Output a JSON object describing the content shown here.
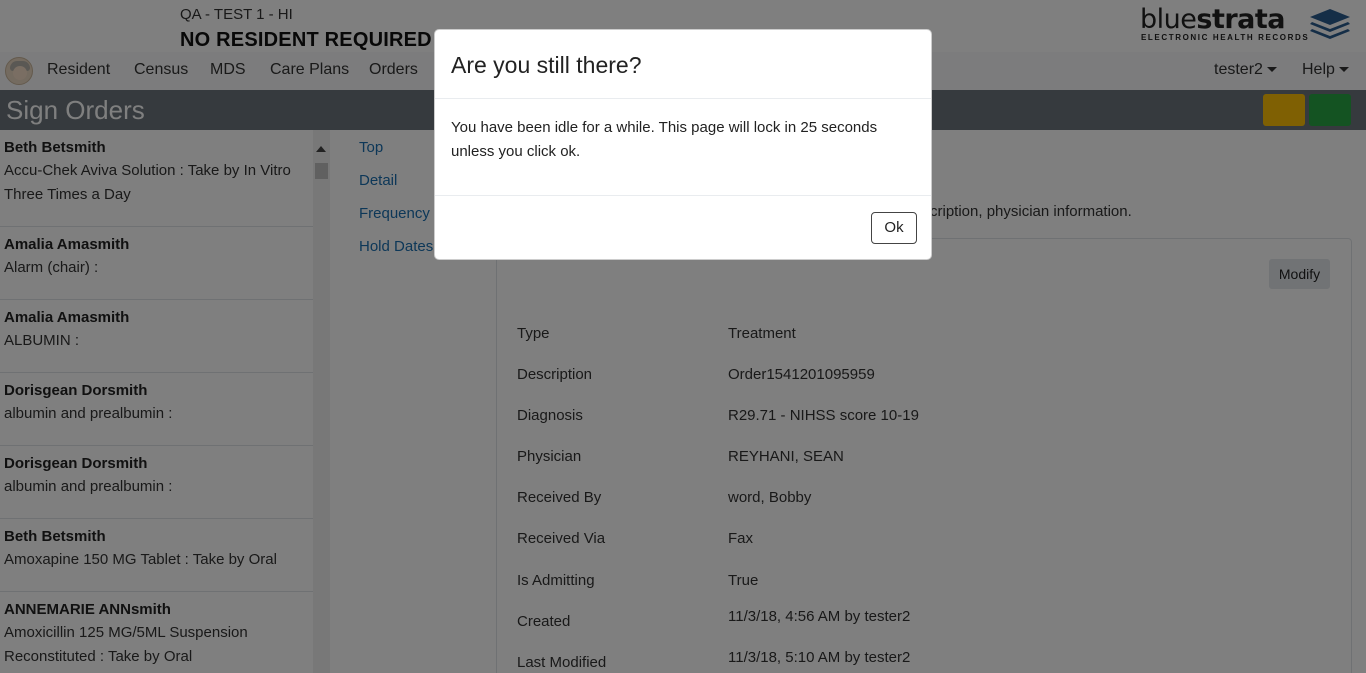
{
  "header": {
    "facility": "QA - TEST 1 - HI",
    "resident": "NO RESIDENT REQUIRED",
    "logo_blue": "blue",
    "logo_strata": "strata",
    "logo_sub": "ELECTRONIC HEALTH RECORDS"
  },
  "nav": {
    "items": [
      "Resident",
      "Census",
      "MDS",
      "Care Plans",
      "Orders"
    ],
    "user": "tester2",
    "help": "Help"
  },
  "page": {
    "title": "Sign Orders"
  },
  "orders": [
    {
      "name": "Beth Betsmith",
      "desc": "Accu-Chek Aviva Solution : Take by In Vitro Three Times a Day"
    },
    {
      "name": "Amalia Amasmith",
      "desc": "Alarm (chair) :"
    },
    {
      "name": "Amalia Amasmith",
      "desc": "ALBUMIN :"
    },
    {
      "name": "Dorisgean Dorsmith",
      "desc": "albumin and prealbumin :"
    },
    {
      "name": "Dorisgean Dorsmith",
      "desc": "albumin and prealbumin :"
    },
    {
      "name": "Beth Betsmith",
      "desc": "Amoxapine 150 MG Tablet : Take by Oral"
    },
    {
      "name": "ANNEMARIE ANNsmith",
      "desc": "Amoxicillin 125 MG/5ML Suspension Reconstituted : Take by Oral"
    }
  ],
  "anchors": [
    "Top",
    "Detail",
    "Frequency",
    "Hold Dates"
  ],
  "detail": {
    "description_tail": "cription, physician information.",
    "modify_label": "Modify",
    "fields": [
      {
        "label": "Type",
        "value": "Treatment"
      },
      {
        "label": "Description",
        "value": "Order1541201095959"
      },
      {
        "label": "Diagnosis",
        "value": "R29.71 - NIHSS score 10-19"
      },
      {
        "label": "Physician",
        "value": "REYHANI, SEAN"
      },
      {
        "label": "Received By",
        "value": "word, Bobby"
      },
      {
        "label": "Received Via",
        "value": "Fax"
      },
      {
        "label": "Is Admitting",
        "value": "True"
      },
      {
        "label": "Created",
        "value": "11/3/18, 4:56 AM by tester2"
      },
      {
        "label": "Last Modified",
        "value": "11/3/18, 5:10 AM by tester2"
      }
    ]
  },
  "modal": {
    "title": "Are you still there?",
    "body": "You have been idle for a while. This page will lock in 25 seconds unless you click ok.",
    "ok_label": "Ok"
  },
  "colors": {
    "title_bar": "#6c757d",
    "yellow_button": "#ffc107",
    "green_button": "#28a745",
    "link": "#1a6fb0",
    "logo_blue": "#2a5d8f"
  }
}
